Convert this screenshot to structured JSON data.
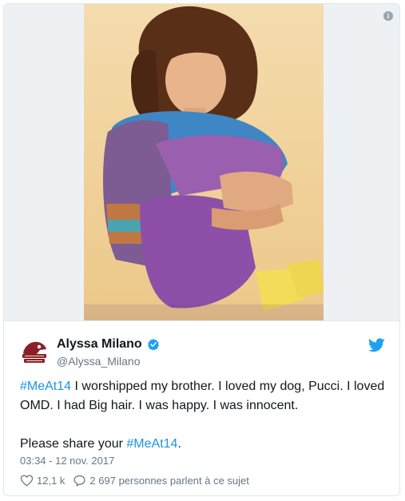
{
  "media": {
    "info_symbol": "i"
  },
  "author": {
    "name": "Alyssa Milano",
    "handle": "@Alyssa_Milano",
    "verified": true
  },
  "tweet": {
    "line1_hashtag": "#MeAt14",
    "line1_text": " I worshipped my brother. I loved my dog, Pucci. I loved OMD. I had Big hair. I was happy. I was innocent.",
    "line2_prefix": "Please share your ",
    "line2_hashtag": "#MeAt14",
    "line2_suffix": "."
  },
  "timestamp": "03:34 - 12 nov. 2017",
  "stats": {
    "likes": "12,1 k",
    "conversation": "2 697 personnes parlent à ce sujet"
  },
  "icons": {
    "info": "info-icon",
    "verified": "verified-badge-icon",
    "brand": "twitter-bird-icon",
    "like": "heart-icon",
    "reply": "speech-bubble-icon"
  },
  "colors": {
    "hashtag": "#1b95e0",
    "verified": "#1da1f2",
    "brand": "#1da1f2",
    "secondary_text": "#657786"
  }
}
